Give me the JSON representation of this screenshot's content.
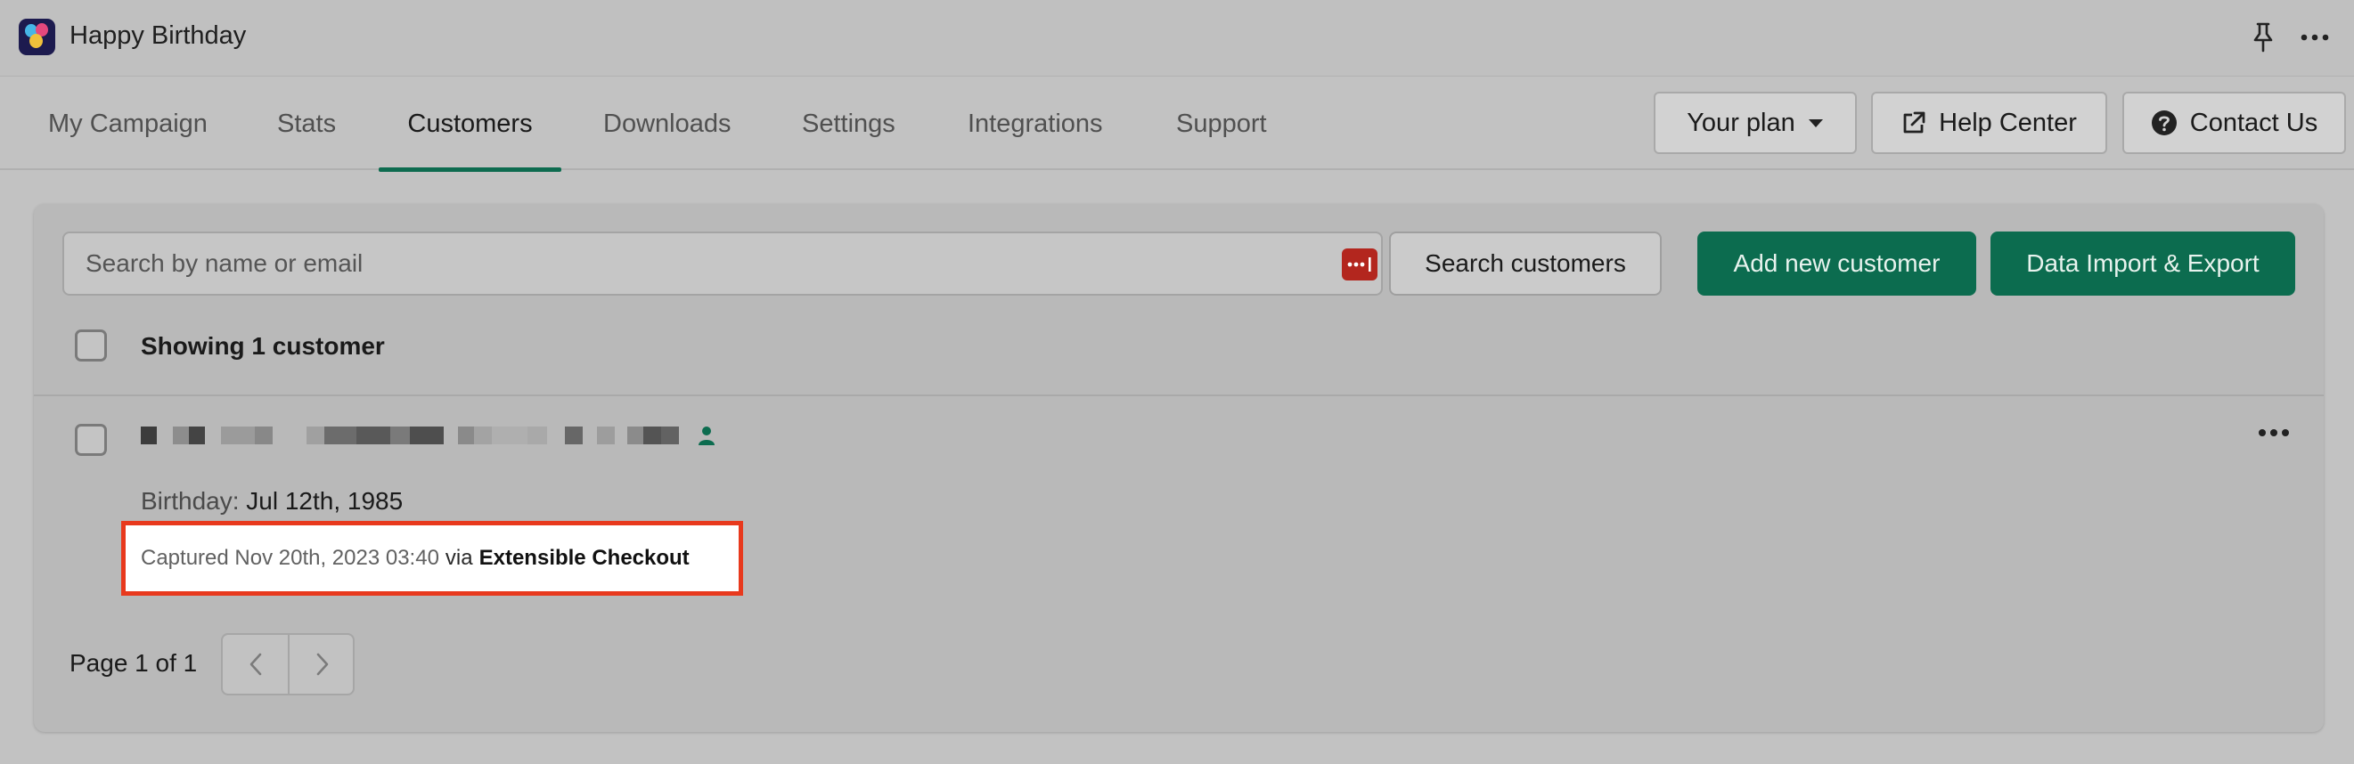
{
  "app": {
    "title": "Happy Birthday"
  },
  "tabs": [
    {
      "label": "My Campaign"
    },
    {
      "label": "Stats"
    },
    {
      "label": "Customers",
      "active": true
    },
    {
      "label": "Downloads"
    },
    {
      "label": "Settings"
    },
    {
      "label": "Integrations"
    },
    {
      "label": "Support"
    }
  ],
  "header_buttons": {
    "plan": "Your plan",
    "help": "Help Center",
    "contact": "Contact Us"
  },
  "search": {
    "placeholder": "Search by name or email",
    "value": "",
    "button": "Search customers"
  },
  "actions": {
    "add": "Add new customer",
    "import_export": "Data Import & Export"
  },
  "list": {
    "showing": "Showing 1 customer"
  },
  "customer": {
    "birthday_label": "Birthday:",
    "birthday_value": "Jul 12th, 1985",
    "captured_text": "Captured Nov 20th, 2023 03:40",
    "via": "via",
    "source": "Extensible Checkout"
  },
  "pagination": {
    "text": "Page 1 of 1"
  },
  "colors": {
    "accent": "#0c6c4f",
    "highlight_border": "#e8391d",
    "password_icon": "#b3261e"
  },
  "icons": [
    "app-logo-icon",
    "pin-icon",
    "more-horizontal-icon",
    "caret-down-icon",
    "external-link-icon",
    "question-circle-icon",
    "password-manager-icon",
    "person-icon",
    "chevron-left-icon",
    "chevron-right-icon"
  ]
}
